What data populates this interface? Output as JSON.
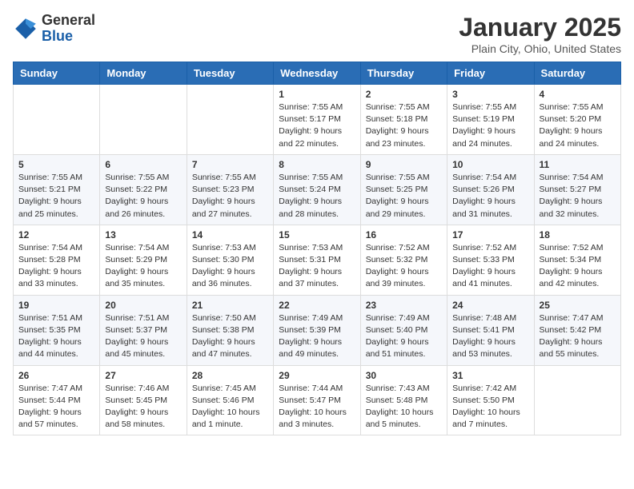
{
  "header": {
    "logo_general": "General",
    "logo_blue": "Blue",
    "month_title": "January 2025",
    "location": "Plain City, Ohio, United States"
  },
  "weekdays": [
    "Sunday",
    "Monday",
    "Tuesday",
    "Wednesday",
    "Thursday",
    "Friday",
    "Saturday"
  ],
  "weeks": [
    [
      {
        "day": "",
        "sunrise": "",
        "sunset": "",
        "daylight": ""
      },
      {
        "day": "",
        "sunrise": "",
        "sunset": "",
        "daylight": ""
      },
      {
        "day": "",
        "sunrise": "",
        "sunset": "",
        "daylight": ""
      },
      {
        "day": "1",
        "sunrise": "7:55 AM",
        "sunset": "5:17 PM",
        "daylight": "9 hours and 22 minutes."
      },
      {
        "day": "2",
        "sunrise": "7:55 AM",
        "sunset": "5:18 PM",
        "daylight": "9 hours and 23 minutes."
      },
      {
        "day": "3",
        "sunrise": "7:55 AM",
        "sunset": "5:19 PM",
        "daylight": "9 hours and 24 minutes."
      },
      {
        "day": "4",
        "sunrise": "7:55 AM",
        "sunset": "5:20 PM",
        "daylight": "9 hours and 24 minutes."
      }
    ],
    [
      {
        "day": "5",
        "sunrise": "7:55 AM",
        "sunset": "5:21 PM",
        "daylight": "9 hours and 25 minutes."
      },
      {
        "day": "6",
        "sunrise": "7:55 AM",
        "sunset": "5:22 PM",
        "daylight": "9 hours and 26 minutes."
      },
      {
        "day": "7",
        "sunrise": "7:55 AM",
        "sunset": "5:23 PM",
        "daylight": "9 hours and 27 minutes."
      },
      {
        "day": "8",
        "sunrise": "7:55 AM",
        "sunset": "5:24 PM",
        "daylight": "9 hours and 28 minutes."
      },
      {
        "day": "9",
        "sunrise": "7:55 AM",
        "sunset": "5:25 PM",
        "daylight": "9 hours and 29 minutes."
      },
      {
        "day": "10",
        "sunrise": "7:54 AM",
        "sunset": "5:26 PM",
        "daylight": "9 hours and 31 minutes."
      },
      {
        "day": "11",
        "sunrise": "7:54 AM",
        "sunset": "5:27 PM",
        "daylight": "9 hours and 32 minutes."
      }
    ],
    [
      {
        "day": "12",
        "sunrise": "7:54 AM",
        "sunset": "5:28 PM",
        "daylight": "9 hours and 33 minutes."
      },
      {
        "day": "13",
        "sunrise": "7:54 AM",
        "sunset": "5:29 PM",
        "daylight": "9 hours and 35 minutes."
      },
      {
        "day": "14",
        "sunrise": "7:53 AM",
        "sunset": "5:30 PM",
        "daylight": "9 hours and 36 minutes."
      },
      {
        "day": "15",
        "sunrise": "7:53 AM",
        "sunset": "5:31 PM",
        "daylight": "9 hours and 37 minutes."
      },
      {
        "day": "16",
        "sunrise": "7:52 AM",
        "sunset": "5:32 PM",
        "daylight": "9 hours and 39 minutes."
      },
      {
        "day": "17",
        "sunrise": "7:52 AM",
        "sunset": "5:33 PM",
        "daylight": "9 hours and 41 minutes."
      },
      {
        "day": "18",
        "sunrise": "7:52 AM",
        "sunset": "5:34 PM",
        "daylight": "9 hours and 42 minutes."
      }
    ],
    [
      {
        "day": "19",
        "sunrise": "7:51 AM",
        "sunset": "5:35 PM",
        "daylight": "9 hours and 44 minutes."
      },
      {
        "day": "20",
        "sunrise": "7:51 AM",
        "sunset": "5:37 PM",
        "daylight": "9 hours and 45 minutes."
      },
      {
        "day": "21",
        "sunrise": "7:50 AM",
        "sunset": "5:38 PM",
        "daylight": "9 hours and 47 minutes."
      },
      {
        "day": "22",
        "sunrise": "7:49 AM",
        "sunset": "5:39 PM",
        "daylight": "9 hours and 49 minutes."
      },
      {
        "day": "23",
        "sunrise": "7:49 AM",
        "sunset": "5:40 PM",
        "daylight": "9 hours and 51 minutes."
      },
      {
        "day": "24",
        "sunrise": "7:48 AM",
        "sunset": "5:41 PM",
        "daylight": "9 hours and 53 minutes."
      },
      {
        "day": "25",
        "sunrise": "7:47 AM",
        "sunset": "5:42 PM",
        "daylight": "9 hours and 55 minutes."
      }
    ],
    [
      {
        "day": "26",
        "sunrise": "7:47 AM",
        "sunset": "5:44 PM",
        "daylight": "9 hours and 57 minutes."
      },
      {
        "day": "27",
        "sunrise": "7:46 AM",
        "sunset": "5:45 PM",
        "daylight": "9 hours and 58 minutes."
      },
      {
        "day": "28",
        "sunrise": "7:45 AM",
        "sunset": "5:46 PM",
        "daylight": "10 hours and 1 minute."
      },
      {
        "day": "29",
        "sunrise": "7:44 AM",
        "sunset": "5:47 PM",
        "daylight": "10 hours and 3 minutes."
      },
      {
        "day": "30",
        "sunrise": "7:43 AM",
        "sunset": "5:48 PM",
        "daylight": "10 hours and 5 minutes."
      },
      {
        "day": "31",
        "sunrise": "7:42 AM",
        "sunset": "5:50 PM",
        "daylight": "10 hours and 7 minutes."
      },
      {
        "day": "",
        "sunrise": "",
        "sunset": "",
        "daylight": ""
      }
    ]
  ]
}
